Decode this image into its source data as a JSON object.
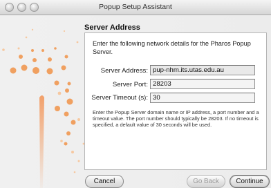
{
  "window": {
    "title": "Popup Setup Assistant"
  },
  "page": {
    "heading": "Server Address",
    "intro": "Enter the following network details for the Pharos Popup Server.",
    "help": "Enter the Popup Server domain name or IP address, a port number and a timeout value. The port number should typically be 28203. If no timeout is specified, a default value of 30 seconds will be used."
  },
  "form": {
    "server_address_label": "Server Address:",
    "server_address_value": "pup-nhm.its.utas.edu.au",
    "server_port_label": "Server Port:",
    "server_port_value": "28203",
    "server_timeout_label": "Server Timeout (s):",
    "server_timeout_value": "30"
  },
  "buttons": {
    "cancel": "Cancel",
    "go_back": "Go Back",
    "continue": "Continue"
  },
  "colors": {
    "dot_orange": "#f0a060",
    "dot_light": "#f6c8a0"
  }
}
